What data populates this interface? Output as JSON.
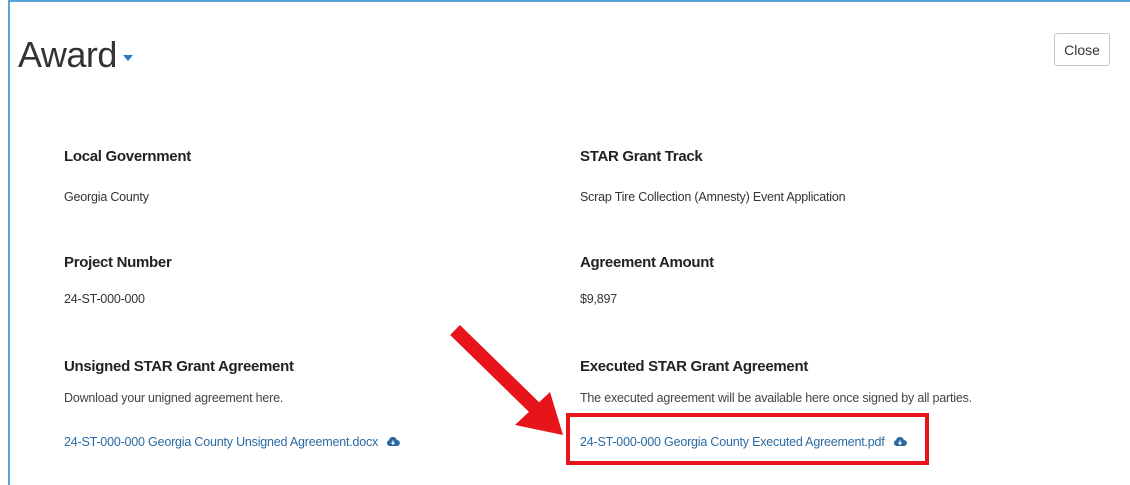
{
  "header": {
    "title": "Award",
    "close_label": "Close"
  },
  "fields": {
    "local_government": {
      "label": "Local Government",
      "value": "Georgia County"
    },
    "grant_track": {
      "label": "STAR Grant Track",
      "value": "Scrap Tire Collection (Amnesty) Event Application"
    },
    "project_number": {
      "label": "Project Number",
      "value": "24-ST-000-000"
    },
    "agreement_amount": {
      "label": "Agreement Amount",
      "value": "$9,897"
    },
    "unsigned_agreement": {
      "label": "Unsigned STAR Grant Agreement",
      "description": "Download your unigned agreement here.",
      "link": "24-ST-000-000 Georgia County Unsigned Agreement.docx"
    },
    "executed_agreement": {
      "label": "Executed STAR Grant Agreement",
      "description": "The executed agreement will be available here once signed by all parties.",
      "link": "24-ST-000-000 Georgia County Executed Agreement.pdf"
    }
  },
  "colors": {
    "accent": "#2a6aa3",
    "highlight": "#e8141b",
    "panel_border": "#5aa3d8"
  },
  "icons": {
    "download": "cloud-download-icon",
    "dropdown": "caret-down-icon",
    "annotation": "red-arrow-icon"
  }
}
